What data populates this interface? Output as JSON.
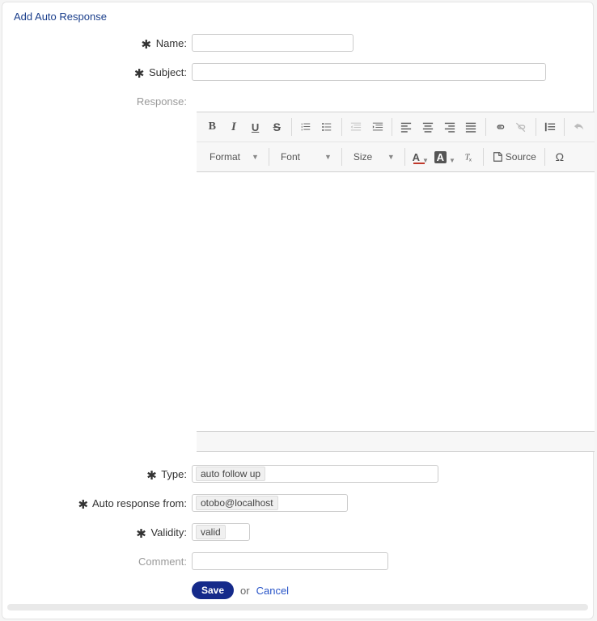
{
  "panel": {
    "title": "Add Auto Response"
  },
  "labels": {
    "name": "Name:",
    "subject": "Subject:",
    "response": "Response:",
    "type": "Type:",
    "from": "Auto response from:",
    "validity": "Validity:",
    "comment": "Comment:"
  },
  "required_marker": "✱",
  "values": {
    "name": "",
    "subject": "",
    "type": "auto follow up",
    "from": "otobo@localhost",
    "validity": "valid",
    "comment": ""
  },
  "editor": {
    "toolbar": {
      "format_label": "Format",
      "font_label": "Font",
      "size_label": "Size",
      "source_label": "Source",
      "text_color_letter": "A",
      "bg_color_letter": "A",
      "omega": "Ω"
    }
  },
  "icons": {
    "bold": "B",
    "italic": "I",
    "underline": "U",
    "strike": "S"
  },
  "actions": {
    "save": "Save",
    "or": "or",
    "cancel": "Cancel"
  }
}
